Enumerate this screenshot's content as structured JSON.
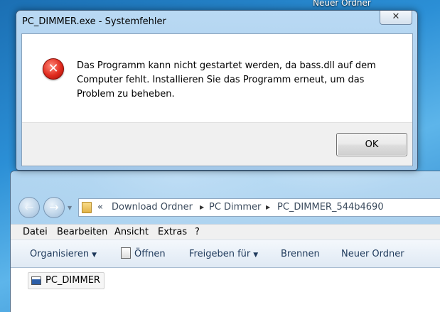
{
  "desktop": {
    "icon_label": "Neuer Ordner"
  },
  "dialog": {
    "title": "PC_DIMMER.exe - Systemfehler",
    "close_label": "✕",
    "icon": "error-icon",
    "message": "Das Programm kann nicht gestartet werden, da bass.dll auf dem Computer fehlt. Installieren Sie das Programm erneut, um das Problem zu beheben.",
    "ok_label": "OK"
  },
  "explorer": {
    "back_label": "←",
    "forward_label": "→",
    "address": {
      "overflow": "«",
      "parts": [
        "Download Ordner",
        "PC Dimmer",
        "PC_DIMMER_544b4690"
      ]
    },
    "menu": [
      "Datei",
      "Bearbeiten",
      "Ansicht",
      "Extras",
      "?"
    ],
    "toolbar": {
      "organize": "Organisieren",
      "open": "Öffnen",
      "share": "Freigeben für",
      "burn": "Brennen",
      "new_folder": "Neuer Ordner"
    },
    "files": [
      {
        "name": "PC_DIMMER",
        "icon": "application-icon"
      }
    ]
  }
}
